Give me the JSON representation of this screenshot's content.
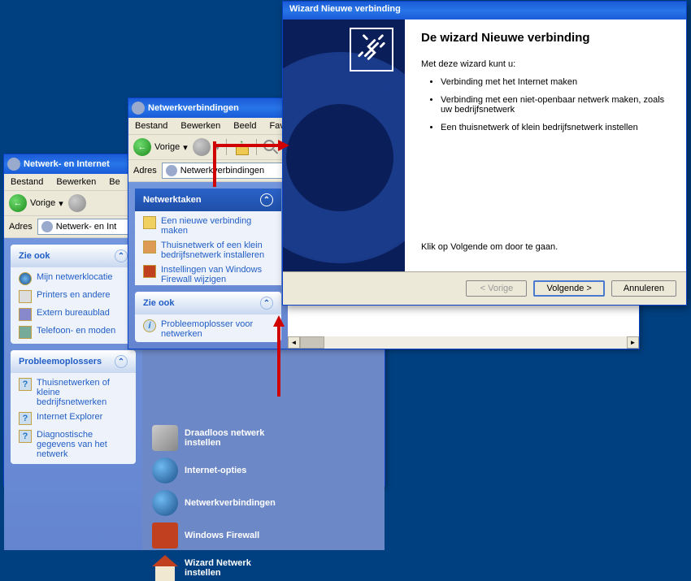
{
  "win1": {
    "title": "Netwerk- en Internet",
    "menu": [
      "Bestand",
      "Bewerken",
      "Be"
    ],
    "back": "Vorige",
    "addr_label": "Adres",
    "addr_value": "Netwerk- en Int",
    "panels": {
      "zie_ook": {
        "header": "Zie ook",
        "items": [
          "Mijn netwerklocatie",
          "Printers en andere",
          "Extern bureaublad",
          "Telefoon- en moden"
        ]
      },
      "probleem": {
        "header": "Probleemoplossers",
        "items": [
          "Thuisnetwerken of kleine bedrijfsnetwerken",
          "Internet Explorer",
          "Diagnostische gegevens van het netwerk"
        ]
      }
    }
  },
  "win2": {
    "title": "Netwerkverbindingen",
    "menu": [
      "Bestand",
      "Bewerken",
      "Beeld",
      "Favor"
    ],
    "back": "Vorige",
    "addr_label": "Adres",
    "addr_value": "Netwerkverbindingen",
    "panels": {
      "taken": {
        "header": "Netwerktaken",
        "items": [
          "Een nieuwe verbinding maken",
          "Thuisnetwerk of een klein bedrijfsnetwerk installeren",
          "Instellingen van Windows Firewall wijzigen"
        ]
      },
      "zie_ook": {
        "header": "Zie ook",
        "items": [
          "Probleemoplosser voor netwerken"
        ]
      }
    }
  },
  "cp_items": [
    "Draadloos netwerk instellen",
    "Internet-opties",
    "Netwerkverbindingen",
    "Windows Firewall",
    "Wizard Netwerk instellen"
  ],
  "wizard": {
    "title": "Wizard Nieuwe verbinding",
    "heading": "De wizard Nieuwe verbinding",
    "intro": "Met deze wizard kunt u:",
    "bullets": [
      "Verbinding met het Internet maken",
      "Verbinding met een niet-openbaar netwerk maken, zoals uw bedrijfsnetwerk",
      "Een thuisnetwerk of klein bedrijfsnetwerk instellen"
    ],
    "next_hint": "Klik op Volgende om door te gaan.",
    "btn_back": "< Vorige",
    "btn_next": "Volgende >",
    "btn_cancel": "Annuleren"
  }
}
